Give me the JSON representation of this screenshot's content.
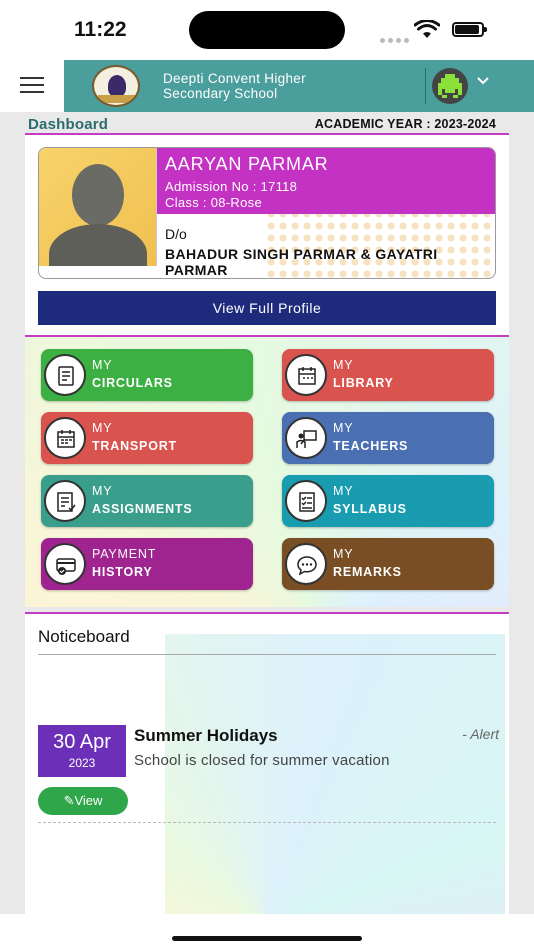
{
  "status": {
    "time": "11:22"
  },
  "header": {
    "school_name_line1": "Deepti Convent Higher",
    "school_name_line2": "Secondary School"
  },
  "dashboard": {
    "title": "Dashboard",
    "academic_year": "ACADEMIC YEAR : 2023-2024"
  },
  "profile": {
    "name": "AARYAN PARMAR",
    "admission": "Admission No : 17118",
    "class": "Class : 08-Rose",
    "relation": "D/o",
    "parents": "BAHADUR SINGH PARMAR & GAYATRI PARMAR",
    "view_button": "View Full Profile"
  },
  "menu": [
    {
      "l1": "MY",
      "l2": "CIRCULARS",
      "color": "#3cb043",
      "icon": "circular-icon"
    },
    {
      "l1": "MY",
      "l2": "LIBRARY",
      "color": "#d9534f",
      "icon": "library-icon"
    },
    {
      "l1": "MY",
      "l2": "TRANSPORT",
      "color": "#d9534f",
      "icon": "transport-icon"
    },
    {
      "l1": "MY",
      "l2": "TEACHERS",
      "color": "#4a6fb3",
      "icon": "teacher-icon"
    },
    {
      "l1": "MY",
      "l2": "ASSIGNMENTS",
      "color": "#3a9e8c",
      "icon": "assignment-icon"
    },
    {
      "l1": "MY",
      "l2": "SYLLABUS",
      "color": "#1a9cb0",
      "icon": "syllabus-icon"
    },
    {
      "l1": "PAYMENT",
      "l2": "HISTORY",
      "color": "#a0248f",
      "icon": "payment-icon"
    },
    {
      "l1": "MY",
      "l2": "REMARKS",
      "color": "#7a4e24",
      "icon": "remarks-icon"
    }
  ],
  "noticeboard": {
    "title": "Noticeboard",
    "items": [
      {
        "day_month": "30 Apr",
        "year": "2023",
        "title": "Summer Holidays",
        "tag": "- Alert",
        "description": "School is closed for summer vacation",
        "view_label": "✎View"
      }
    ]
  },
  "colors": {
    "accent_teal": "#4a9e9c",
    "profile_magenta": "#c432c4",
    "view_profile_navy": "#1e2b7d",
    "date_purple": "#6b2fb8",
    "view_green": "#2fa64a"
  }
}
